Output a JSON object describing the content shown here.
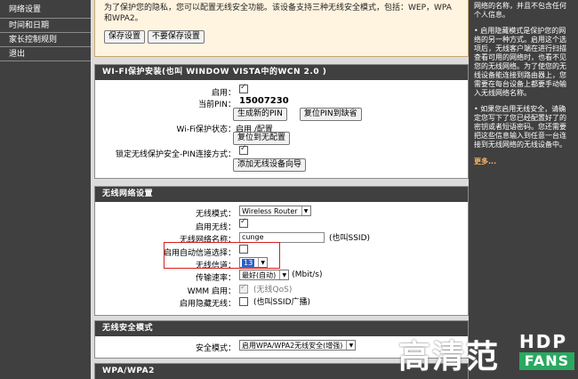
{
  "nav": {
    "items": [
      "网络设置",
      "时间和日期",
      "家长控制规则",
      "退出"
    ]
  },
  "notice": {
    "text": "为了保护您的隐私，您可以配置无线安全功能。该设备支持三种无线安全模式，包括：WEP，WPA和WPA2。",
    "save_label": "保存设置",
    "nosave_label": "不要保存设置"
  },
  "wps": {
    "title": "WI-FI保护安装(也叫 WINDOW VISTA中的WCN 2.0 )",
    "enable_label": "启用：",
    "pin_label": "当前PIN：",
    "pin_value": "15007230",
    "gen_pin_button": "生成新的PIN",
    "reset_pin_button": "复位PIN到缺省",
    "status_label": "Wi-Fi保护状态：",
    "status_value": "启用 /配置",
    "reset_unconfigured_button": "复位到无配置",
    "lock_label": "锁定无线保护安全-PIN连接方式：",
    "add_device_button": "添加无线设备向导"
  },
  "wireless": {
    "title": "无线网络设置",
    "mode_label": "无线模式：",
    "mode_value": "Wireless Router",
    "enable_label": "启用无线：",
    "ssid_label": "无线网络名称：",
    "ssid_value": "cunge",
    "ssid_hint": "(也叫SSID)",
    "auto_channel_label": "启用自动信道选择：",
    "channel_label": "无线信道：",
    "channel_value": "13",
    "rate_label": "传输速率：",
    "rate_value": "最好(自动)",
    "rate_unit": "(Mbit/s)",
    "wmm_label": "WMM 启用：",
    "wmm_hint": "(无线QoS)",
    "hidden_label": "启用隐藏无线：",
    "hidden_hint": "(也叫SSID广播)"
  },
  "security": {
    "title": "无线安全模式",
    "mode_label": "安全模式：",
    "mode_value": "启用WPA/WPA2无线安全(增强)"
  },
  "wpa": {
    "title": "WPA/WPA2"
  },
  "help": {
    "p1": "网络的名称，并且不包含任何个人信息。",
    "p2": "• 启用隐藏模式是保护您的网络的另一种方式。启用这个选项后，无线客户端在进行扫描查看可用的网络时，也看不见您的无线网络。为了使您的无线设备能连接到路由器上，您需要在每台设备上都要手动输入无线网络名称。",
    "p3": "• 如果您启用无线安全，请确定您写下了您已经配置好了的密钥或者短语密码。您还需要把这些信息输入到任意一台连接到无线网络的无线设备中。",
    "more": "更多..."
  },
  "watermark": {
    "cn": "高清范",
    "hdp": "HDP",
    "fans": "FANS"
  }
}
